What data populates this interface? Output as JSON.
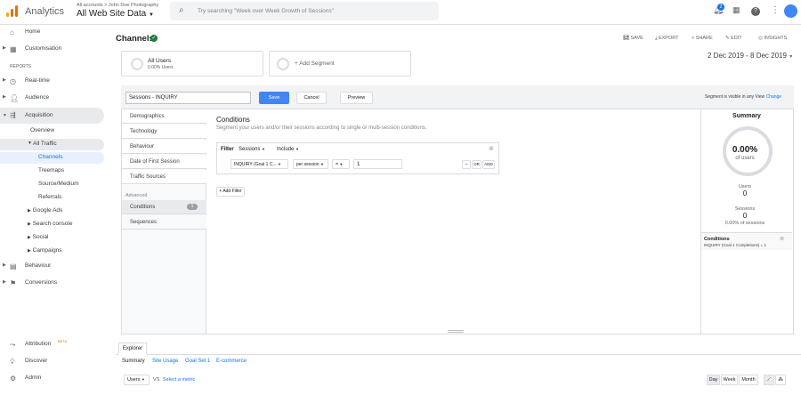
{
  "header": {
    "brand": "Analytics",
    "breadcrumb": "All accounts > John Doe Photography",
    "view_name": "All Web Site Data",
    "search_placeholder": "Try searching \"Week over Week Growth of Sessions\"",
    "notification_count": "2"
  },
  "sidebar": {
    "home": "Home",
    "customisation": "Customisation",
    "reports_heading": "REPORTS",
    "realtime": "Real-time",
    "audience": "Audience",
    "acquisition": "Acquisition",
    "overview": "Overview",
    "all_traffic": "All Traffic",
    "channels": "Channels",
    "treemaps": "Treemaps",
    "source_medium": "Source/Medium",
    "referrals": "Referrals",
    "google_ads": "Google Ads",
    "search_console": "Search console",
    "social": "Social",
    "campaigns": "Campaigns",
    "behaviour": "Behaviour",
    "conversions": "Conversions",
    "attribution": "Attribution",
    "attribution_badge": "BETA",
    "discover": "Discover",
    "admin": "Admin"
  },
  "page": {
    "title": "Channels",
    "actions": {
      "save": "SAVE",
      "export": "EXPORT",
      "share": "SHARE",
      "edit": "EDIT",
      "insights": "INSIGHTS"
    },
    "segment_all_users": "All Users",
    "segment_all_users_pct": "0.00% Users",
    "add_segment": "+ Add Segment",
    "date_range": "2 Dec 2019 - 8 Dec 2019"
  },
  "editor": {
    "segment_name": "Sessions - INQUIRY",
    "save": "Save",
    "cancel": "Cancel",
    "preview": "Preview",
    "visibility_note": "Segment is visible in any View",
    "change": "Change",
    "nav": [
      "Demographics",
      "Technology",
      "Behaviour",
      "Date of First Session",
      "Traffic Sources"
    ],
    "advanced": "Advanced",
    "conditions": "Conditions",
    "conditions_count": "1",
    "sequences": "Sequences",
    "conditions_title": "Conditions",
    "conditions_desc": "Segment your users and/or their sessions according to single or multi-session conditions.",
    "filter_label": "Filter",
    "filter_scope": "Sessions",
    "filter_include": "Include",
    "metric": "INQUIRY (Goal 1 C...",
    "per": "per session",
    "op": "=",
    "value": "1",
    "minus": "−",
    "or": "OR",
    "and": "AND",
    "add_filter": "+ Add Filter"
  },
  "summary": {
    "title": "Summary",
    "pct": "0.00%",
    "of_users": "of users",
    "users_label": "Users",
    "users_value": "0",
    "sessions_label": "Sessions",
    "sessions_value": "0",
    "sessions_pct": "0.00% of sessions",
    "cond_title": "Conditions",
    "cond_detail": "INQUIRY (Goal 1 Completions) = 1"
  },
  "explorer": {
    "tab": "Explorer",
    "subtabs": [
      "Summary",
      "Site Usage",
      "Goal Set 1",
      "E-commerce"
    ],
    "metric": "Users",
    "vs": "VS",
    "select_metric": "Select a metric",
    "day": "Day",
    "week": "Week",
    "month": "Month"
  }
}
